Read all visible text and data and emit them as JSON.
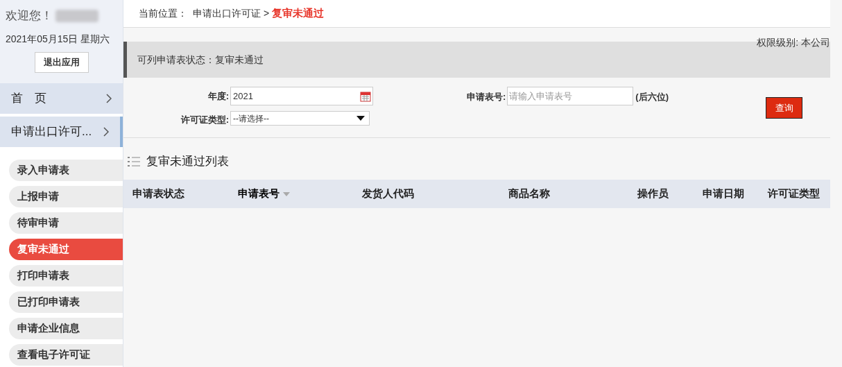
{
  "user": {
    "greeting": "欢迎您！",
    "date": "2021年05月15日 星期六",
    "logout": "退出应用"
  },
  "nav": [
    {
      "label": "首　页",
      "selected": false
    },
    {
      "label": "申请出口许可...",
      "selected": true
    }
  ],
  "subnav": [
    {
      "label": "录入申请表",
      "selected": false
    },
    {
      "label": "上报申请",
      "selected": false
    },
    {
      "label": "待审申请",
      "selected": false
    },
    {
      "label": "复审未通过",
      "selected": true
    },
    {
      "label": "打印申请表",
      "selected": false
    },
    {
      "label": "已打印申请表",
      "selected": false
    },
    {
      "label": "申请企业信息",
      "selected": false
    },
    {
      "label": "查看电子许可证",
      "selected": false
    }
  ],
  "breadcrumb": {
    "prefix": "当前位置：",
    "parent": "申请出口许可证",
    "separator": ">",
    "current": "复审未通过"
  },
  "permission": "权限级别: 本公司",
  "status_banner": "可列申请表状态：复审未通过",
  "filters": {
    "year_label": "年度:",
    "year_value": "2021",
    "type_label": "许可证类型:",
    "type_value": "--请选择--",
    "number_label": "申请表号:",
    "number_placeholder": "请输入申请表号",
    "number_hint": "(后六位)",
    "query": "查询"
  },
  "table": {
    "title": "复审未通过列表",
    "columns": [
      {
        "label": "申请表状态",
        "sorted": false
      },
      {
        "label": "申请表号",
        "sorted": true
      },
      {
        "label": "发货人代码",
        "sorted": false
      },
      {
        "label": "商品名称",
        "sorted": false
      },
      {
        "label": "操作员",
        "sorted": false
      },
      {
        "label": "申请日期",
        "sorted": false
      },
      {
        "label": "许可证类型",
        "sorted": false
      }
    ]
  }
}
